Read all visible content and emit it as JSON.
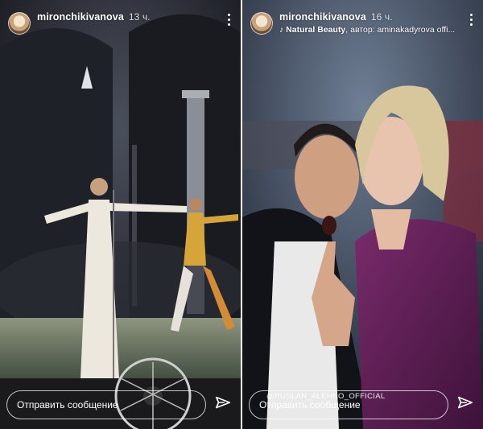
{
  "left_story": {
    "username": "mironchikivanova",
    "time_ago": "13 ч.",
    "reply_placeholder": "Отправить сообщение"
  },
  "right_story": {
    "username": "mironchikivanova",
    "time_ago": "16 ч.",
    "music_title": "Natural Beauty",
    "music_author": "автор: aminakadyrova offi...",
    "mention_tag": "@RUSLAN_ALEHNO_OFFICIAL",
    "reply_placeholder": "Отправить сообщение"
  },
  "icons": [
    "avatar",
    "more-options-icon",
    "music-note-icon",
    "send-icon"
  ],
  "colors": {
    "stage_bg": "#1b1c22",
    "dress": "#e8e4da",
    "velvet": "#5a1f4f"
  }
}
